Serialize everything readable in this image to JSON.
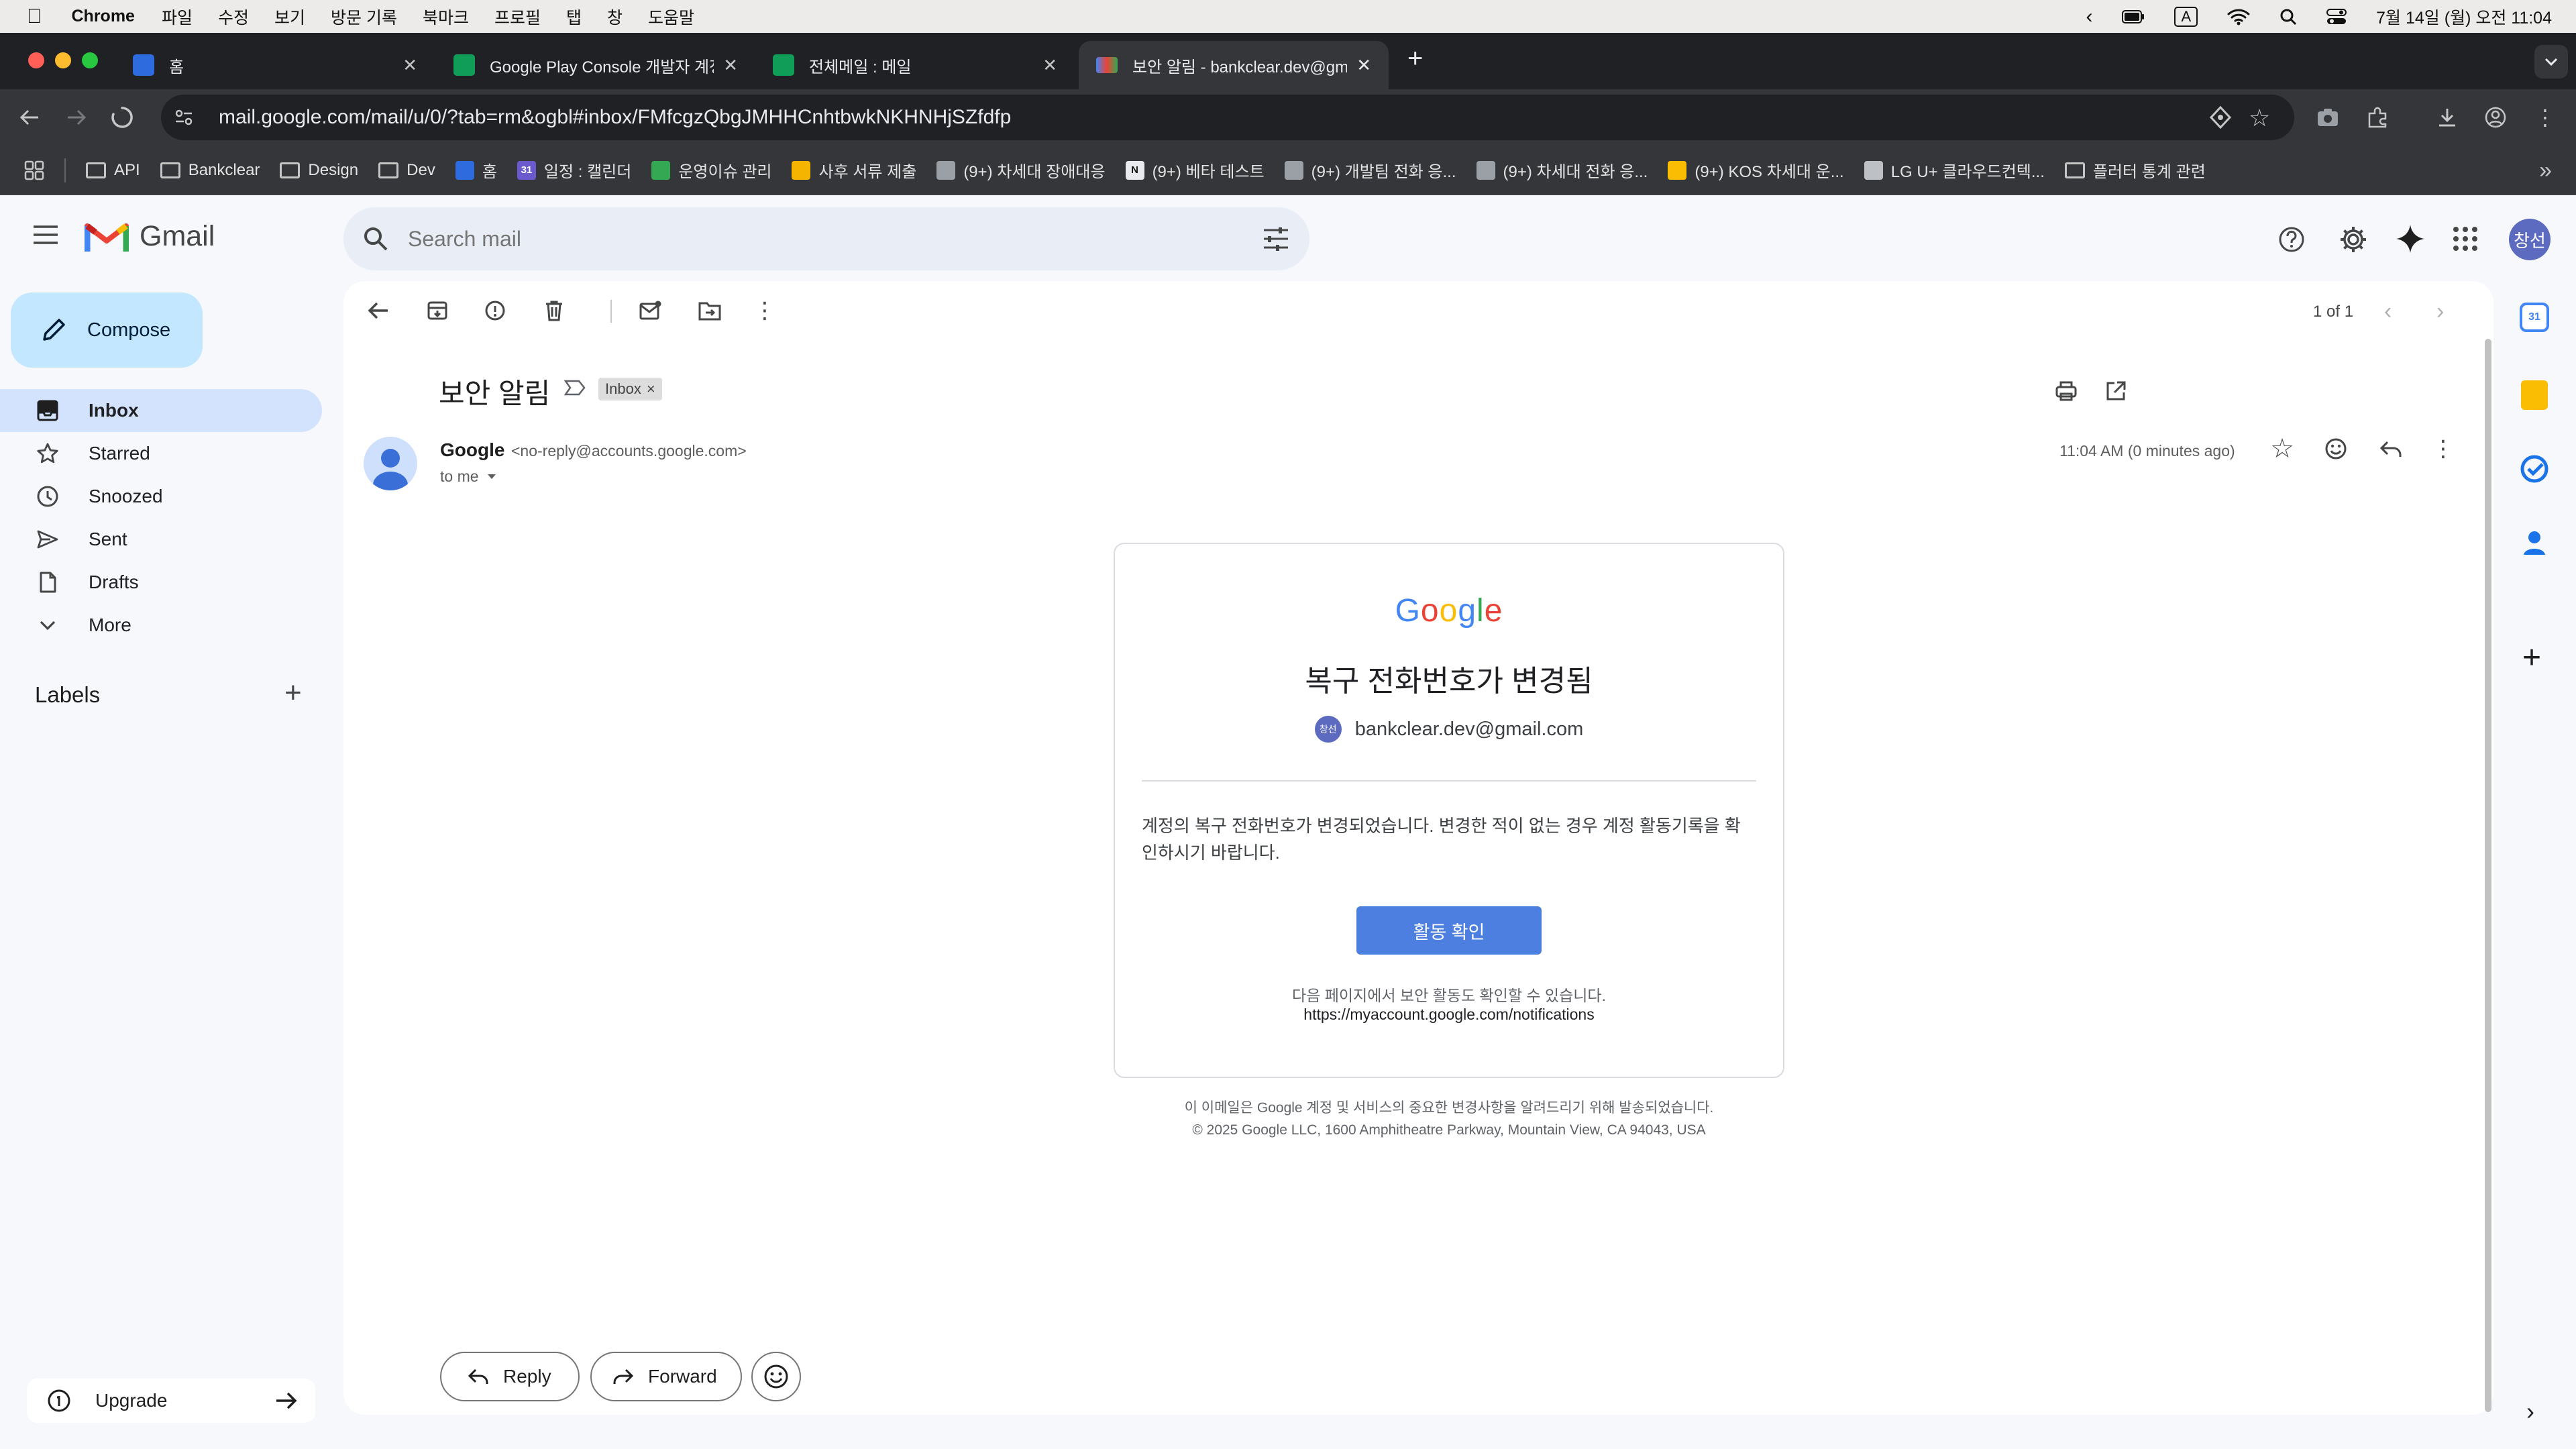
{
  "menubar": {
    "app": "Chrome",
    "items": [
      "파일",
      "수정",
      "보기",
      "방문 기록",
      "북마크",
      "프로필",
      "탭",
      "창",
      "도움말"
    ],
    "datetime": "7월 14일 (월) 오전 11:04",
    "input_indicator": "A"
  },
  "tabs": [
    {
      "title": "홈",
      "color": "#2d6bde"
    },
    {
      "title": "Google Play Console 개발자 계정",
      "color": "#0f9d58"
    },
    {
      "title": "전체메일 : 메일",
      "color": "#0f9d58"
    },
    {
      "title": "보안 알림 - bankclear.dev@gmail.com",
      "color": "#ea4335",
      "active": true
    }
  ],
  "toolbar": {
    "url": "mail.google.com/mail/u/0/?tab=rm&ogbl#inbox/FMfcgzQbgJMHHCnhtbwkNKHNHjSZfdfp"
  },
  "bookmarks": [
    {
      "label": "API",
      "type": "folder"
    },
    {
      "label": "Bankclear",
      "type": "folder"
    },
    {
      "label": "Design",
      "type": "folder"
    },
    {
      "label": "Dev",
      "type": "folder"
    },
    {
      "label": "홈",
      "type": "site",
      "color": "#2d6bde"
    },
    {
      "label": "일정 : 캘린더",
      "type": "site",
      "color": "#6a5acd",
      "glyph": "31"
    },
    {
      "label": "운영이슈 관리",
      "type": "site",
      "color": "#34a853"
    },
    {
      "label": "사후 서류 제출",
      "type": "site",
      "color": "#f4b400"
    },
    {
      "label": "(9+) 차세대 장애대응",
      "type": "site",
      "color": "#9aa0a6"
    },
    {
      "label": "(9+) 베타 테스트",
      "type": "site",
      "color": "#e8eaed",
      "glyph": "N"
    },
    {
      "label": "(9+) 개발팀 전화 응...",
      "type": "site",
      "color": "#9aa0a6"
    },
    {
      "label": "(9+) 차세대 전화 응...",
      "type": "site",
      "color": "#9aa0a6"
    },
    {
      "label": "(9+) KOS 차세대 운...",
      "type": "site",
      "color": "#fbbc04"
    },
    {
      "label": "LG U+ 클라우드컨텍...",
      "type": "site",
      "color": "#bdc1c6"
    },
    {
      "label": "플러터 통계 관련",
      "type": "folder"
    }
  ],
  "gmail": {
    "brand": "Gmail",
    "search_placeholder": "Search mail",
    "compose": "Compose",
    "nav": [
      {
        "label": "Inbox",
        "icon": "inbox-icon",
        "active": true
      },
      {
        "label": "Starred",
        "icon": "star-icon"
      },
      {
        "label": "Snoozed",
        "icon": "clock-icon"
      },
      {
        "label": "Sent",
        "icon": "send-icon"
      },
      {
        "label": "Drafts",
        "icon": "draft-icon"
      },
      {
        "label": "More",
        "icon": "chevron-down-icon"
      }
    ],
    "labels_heading": "Labels",
    "upgrade": "Upgrade",
    "avatar_text": "창선",
    "pager": "1 of 1"
  },
  "email": {
    "subject": "보안 알림",
    "label_chip": "Inbox",
    "sender_name": "Google",
    "sender_email": "<no-reply@accounts.google.com>",
    "to": "to me",
    "time": "11:04 AM (0 minutes ago)",
    "card": {
      "logo": "Google",
      "title": "복구 전화번호가 변경됨",
      "avatar": "창선",
      "account": "bankclear.dev@gmail.com",
      "body": "계정의 복구 전화번호가 변경되었습니다. 변경한 적이 없는 경우 계정 활동기록을 확인하시기 바랍니다.",
      "button": "활동 확인",
      "note": "다음 페이지에서 보안 활동도 확인할 수 있습니다.",
      "link": "https://myaccount.google.com/notifications"
    },
    "footer_line1": "이 이메일은 Google 계정 및 서비스의 중요한 변경사항을 알려드리기 위해 발송되었습니다.",
    "footer_line2": "© 2025 Google LLC, 1600 Amphitheatre Parkway, Mountain View, CA 94043, USA",
    "reply": "Reply",
    "forward": "Forward"
  }
}
